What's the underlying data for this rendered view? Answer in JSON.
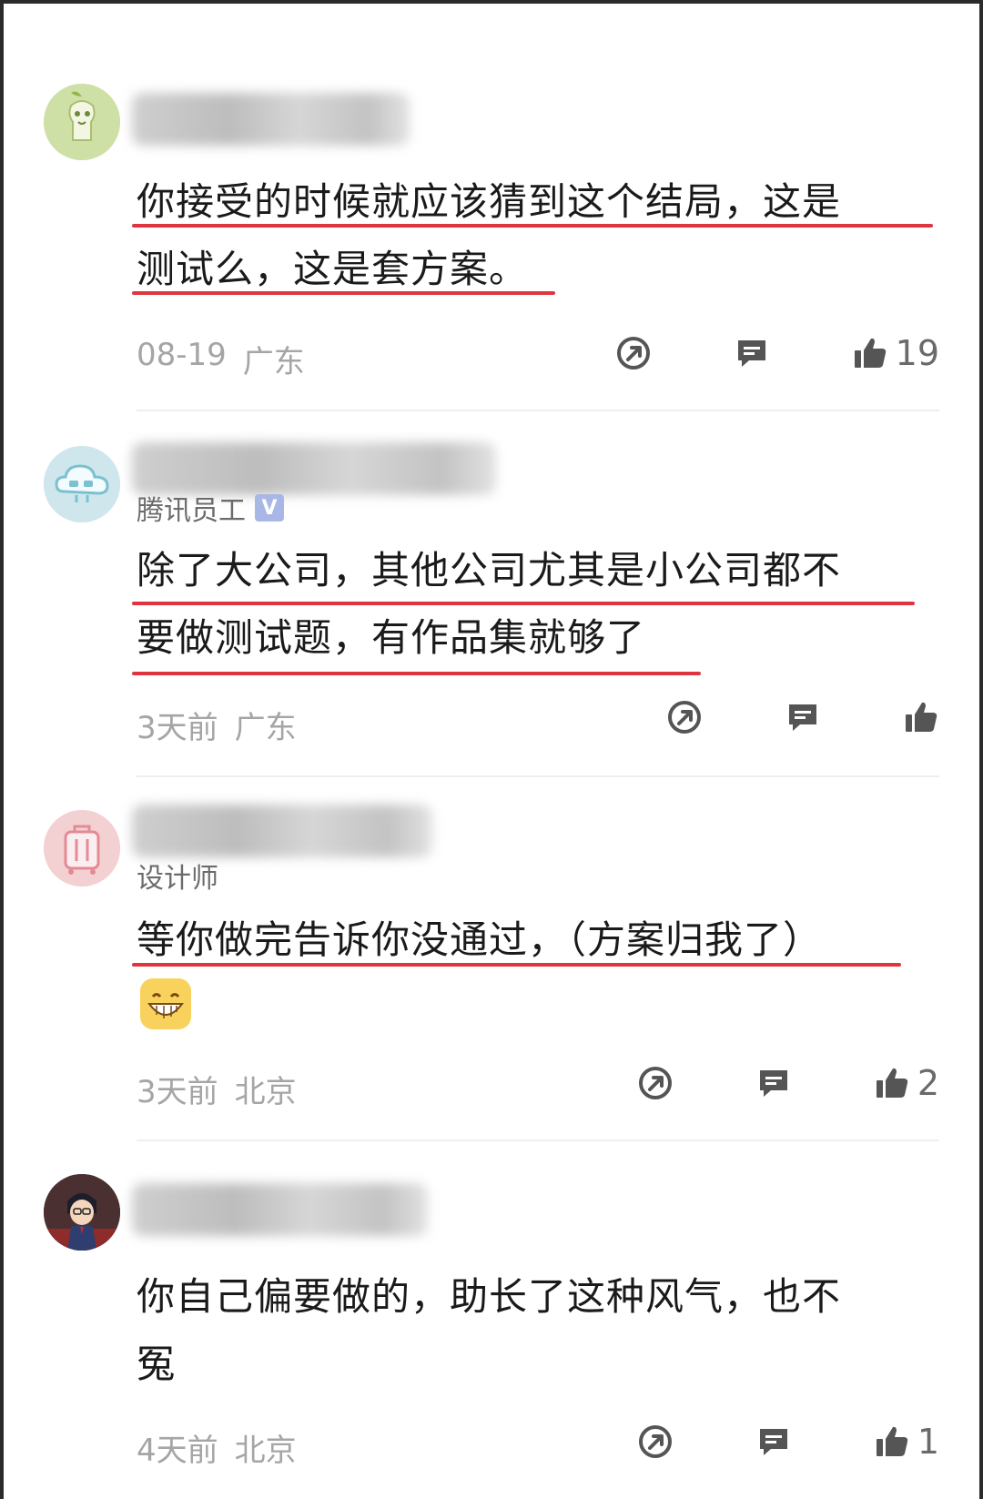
{
  "comments": [
    {
      "tag": "",
      "text_lines": [
        "你接受的时候就应该猜到这个结局，这是",
        "测试么，这是套方案。"
      ],
      "date": "08-19",
      "location": "广东",
      "likes": "19",
      "avatar_color": "#cfe0a6"
    },
    {
      "tag": "腾讯员工",
      "badge": "V",
      "text_lines": [
        "除了大公司，其他公司尤其是小公司都不",
        "要做测试题，有作品集就够了"
      ],
      "date": "3天前",
      "location": "广东",
      "likes": "",
      "avatar_color": "#cfe7ec"
    },
    {
      "tag": "设计师",
      "text_lines": [
        "等你做完告诉你没通过，（方案归我了）"
      ],
      "date": "3天前",
      "location": "北京",
      "likes": "2",
      "avatar_color": "#f3d1d3"
    },
    {
      "tag": "",
      "text_lines": [
        "你自己偏要做的，助长了这种风气，也不",
        "冤"
      ],
      "date": "4天前",
      "location": "北京",
      "likes": "1",
      "avatar_color": "#3a2a2a"
    }
  ],
  "icons": [
    "share-icon",
    "reply-icon",
    "thumbs-up-icon",
    "verified-badge-icon"
  ],
  "colors": {
    "underline": "#e0353e",
    "meta": "#a5a5a5",
    "icon": "#555555"
  }
}
